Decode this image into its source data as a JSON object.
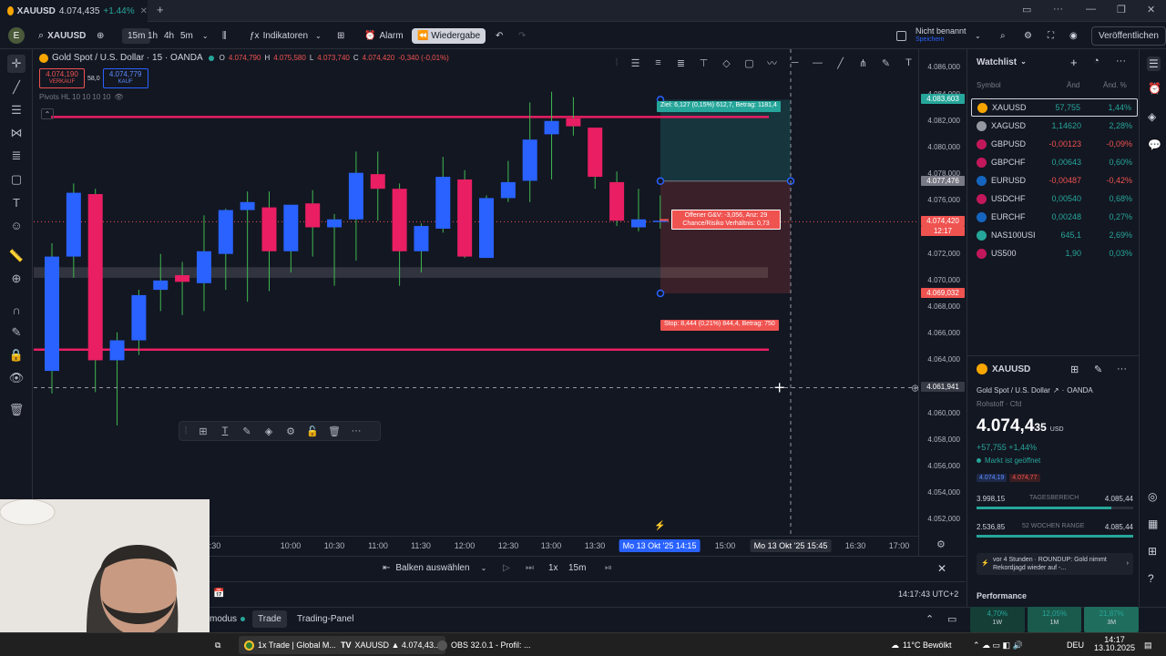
{
  "browser": {
    "tab_title": "XAUUSD ▲ 4.074,435 +1.44% / Un...",
    "tab_symbol": "XAUUSD",
    "tab_price": "4.074,435",
    "tab_change": "+1.44%",
    "new_tab": "+"
  },
  "toolbar": {
    "user_initial": "E",
    "symbol": "XAUUSD",
    "intervals": [
      "15m",
      "1h",
      "4h",
      "5m"
    ],
    "indicators_label": "Indikatoren",
    "alarm_label": "Alarm",
    "replay_label": "Wiedergabe",
    "layout_name": "Nicht benannt",
    "layout_sub": "Speichern",
    "publish_label": "Veröffentlichen"
  },
  "chart": {
    "title": "Gold Spot / U.S. Dollar · 15 · OANDA",
    "ohlc": {
      "o_label": "O",
      "o": "4.074,790",
      "h_label": "H",
      "h": "4.075,580",
      "l_label": "L",
      "l": "4.073,740",
      "c_label": "C",
      "c": "4.074,420",
      "change": "-0,340 (-0,01%)"
    },
    "sell_price": "4.074,190",
    "sell_label": "VERKAUF",
    "spread": "58,0",
    "buy_price": "4.074,779",
    "buy_label": "KAUF",
    "indicator_legend": "Pivots HL 10 10 10 10",
    "target_label": "Ziel: 6,127 (0,15%) 612,7, Betrag: 1181,4",
    "open_pnl_label": "Offener G&V: -3,056, Anz: 29",
    "risk_reward_label": "Chance/Risiko Verhältnis: 0,73",
    "stop_label": "Stop: 8,444 (0,21%) 844,4, Betrag: 750",
    "candles": [
      {
        "o": 4063.2,
        "h": 4072.8,
        "l": 4061.5,
        "c": 4071.8
      },
      {
        "o": 4071.8,
        "h": 4077.3,
        "l": 4070.2,
        "c": 4076.6
      },
      {
        "o": 4076.5,
        "h": 4076.9,
        "l": 4061.6,
        "c": 4064.0
      },
      {
        "o": 4064.0,
        "h": 4066.1,
        "l": 4059.1,
        "c": 4065.5
      },
      {
        "o": 4065.5,
        "h": 4069.3,
        "l": 4064.4,
        "c": 4068.9
      },
      {
        "o": 4069.3,
        "h": 4072.0,
        "l": 4067.7,
        "c": 4070.0
      },
      {
        "o": 4070.4,
        "h": 4071.4,
        "l": 4067.4,
        "c": 4069.9
      },
      {
        "o": 4069.8,
        "h": 4074.9,
        "l": 4067.7,
        "c": 4072.2
      },
      {
        "o": 4072.0,
        "h": 4075.4,
        "l": 4069.3,
        "c": 4075.3
      },
      {
        "o": 4075.3,
        "h": 4076.7,
        "l": 4068.4,
        "c": 4075.9
      },
      {
        "o": 4075.5,
        "h": 4076.7,
        "l": 4069.2,
        "c": 4072.2
      },
      {
        "o": 4072.2,
        "h": 4074.6,
        "l": 4070.6,
        "c": 4075.7
      },
      {
        "o": 4075.8,
        "h": 4076.8,
        "l": 4071.8,
        "c": 4074.0
      },
      {
        "o": 4074.0,
        "h": 4075.0,
        "l": 4069.6,
        "c": 4074.6
      },
      {
        "o": 4074.6,
        "h": 4079.7,
        "l": 4071.5,
        "c": 4078.1
      },
      {
        "o": 4078.0,
        "h": 4079.7,
        "l": 4074.5,
        "c": 4076.9
      },
      {
        "o": 4076.9,
        "h": 4077.3,
        "l": 4069.6,
        "c": 4072.2
      },
      {
        "o": 4072.2,
        "h": 4074.3,
        "l": 4070.6,
        "c": 4074.1
      },
      {
        "o": 4073.9,
        "h": 4079.3,
        "l": 4073.6,
        "c": 4077.8
      },
      {
        "o": 4077.6,
        "h": 4078.3,
        "l": 4071.7,
        "c": 4071.8
      },
      {
        "o": 4071.7,
        "h": 4076.4,
        "l": 4071.7,
        "c": 4076.2
      },
      {
        "o": 4076.2,
        "h": 4079.0,
        "l": 4075.9,
        "c": 4077.4
      },
      {
        "o": 4077.5,
        "h": 4083.4,
        "l": 4075.9,
        "c": 4080.6
      },
      {
        "o": 4081.0,
        "h": 4084.2,
        "l": 4077.6,
        "c": 4082.0
      },
      {
        "o": 4082.2,
        "h": 4083.8,
        "l": 4080.9,
        "c": 4081.6
      },
      {
        "o": 4081.5,
        "h": 4081.5,
        "l": 4076.9,
        "c": 4077.8
      },
      {
        "o": 4077.4,
        "h": 4078.2,
        "l": 4074.1,
        "c": 4074.5
      },
      {
        "o": 4074.0,
        "h": 4076.9,
        "l": 4073.7,
        "c": 4074.6
      },
      {
        "o": 4074.4,
        "h": 4076.4,
        "l": 4073.9,
        "c": 4074.5
      }
    ],
    "resistance_price": 4082.3,
    "support_price": 4064.8,
    "zone_top": 4071.0,
    "zone_bottom": 4070.2,
    "entry_price": 4077.476,
    "target_price": 4083.603,
    "stop_price": 4069.032,
    "crosshair_price": 4061.941,
    "price_min": 4050.8,
    "price_max": 4087.4
  },
  "price_scale": {
    "ticks": [
      "4.086,000",
      "4.084,000",
      "4.082,000",
      "4.080,000",
      "4.078,000",
      "4.076,000",
      "4.074,000",
      "4.072,000",
      "4.070,000",
      "4.068,000",
      "4.066,000",
      "4.064,000",
      "4.062,000",
      "4.060,000",
      "4.058,000",
      "4.056,000",
      "4.054,000",
      "4.052,000"
    ],
    "target_tag": "4.083,603",
    "entry_tag": "4.077,476",
    "last_price_tag": "4.074,420",
    "countdown_tag": "12:17",
    "stop_tag": "4.069,032",
    "crosshair_tag": "4.061,941",
    "colors": {
      "target": "#26a69a",
      "entry": "#787b86",
      "last": "#ef5350",
      "stop": "#ef5350",
      "crosshair": "#363a45"
    }
  },
  "time_scale": {
    "labels": [
      "09:30",
      "10:00",
      "10:30",
      "11:00",
      "11:30",
      "12:00",
      "12:30",
      "13:00",
      "13:30",
      "15:00",
      "16:30",
      "17:00"
    ],
    "start_tag": "Mo 13 Okt '25   14:15",
    "end_tag": "Mo 13 Okt '25   15:45"
  },
  "replay_bar": {
    "select_bar": "Balken auswählen",
    "speed": "1x",
    "interval": "15m"
  },
  "bottom_bar": {
    "time": "14:17:43 UTC+2"
  },
  "panel_bar": {
    "mode": "modus",
    "trade_tab": "Trade",
    "trading_panel_tab": "Trading-Panel"
  },
  "watchlist": {
    "title": "Watchlist",
    "col_symbol": "Symbol",
    "col_change": "Änd",
    "col_pct": "Änd. %",
    "rows": [
      {
        "symbol": "XAUUSD",
        "change": "57,755",
        "pct": "1,44%",
        "dir": "pos",
        "color": "#f7a600"
      },
      {
        "symbol": "XAGUSD",
        "change": "1,14620",
        "pct": "2,28%",
        "dir": "pos",
        "color": "#9598a1"
      },
      {
        "symbol": "GBPUSD",
        "change": "-0,00123",
        "pct": "-0,09%",
        "dir": "neg",
        "color": "#c2185b"
      },
      {
        "symbol": "GBPCHF",
        "change": "0,00643",
        "pct": "0,60%",
        "dir": "pos",
        "color": "#c2185b"
      },
      {
        "symbol": "EURUSD",
        "change": "-0,00487",
        "pct": "-0,42%",
        "dir": "neg",
        "color": "#1565c0"
      },
      {
        "symbol": "USDCHF",
        "change": "0,00540",
        "pct": "0,68%",
        "dir": "pos",
        "color": "#c2185b"
      },
      {
        "symbol": "EURCHF",
        "change": "0,00248",
        "pct": "0,27%",
        "dir": "pos",
        "color": "#1565c0"
      },
      {
        "symbol": "NAS100USI",
        "change": "645,1",
        "pct": "2,69%",
        "dir": "pos",
        "color": "#26a69a"
      },
      {
        "symbol": "US500",
        "change": "1,90",
        "pct": "0,03%",
        "dir": "pos",
        "color": "#c2185b"
      }
    ]
  },
  "detail": {
    "symbol": "XAUUSD",
    "name": "Gold Spot / U.S. Dollar",
    "exchange": "OANDA",
    "category": "Rohstoff · Cfd",
    "price_main": "4.074,4",
    "price_small": "35",
    "currency": "USD",
    "change": "+57,755 +1,44%",
    "market_status": "Markt ist geöffnet",
    "bid": "4.074,19",
    "ask": "4.074,77",
    "day_low": "3.998,15",
    "day_range_label": "TAGESBEREICH",
    "day_high": "4.085,44",
    "wk52_low": "2.536,85",
    "wk52_label": "52 WOCHEN RANGE",
    "wk52_high": "4.085,44",
    "news": "vor 4 Stunden · ROUNDUP: Gold nimmt Rekordjagd wieder auf -...",
    "performance_title": "Performance",
    "perf": [
      {
        "value": "4,70%",
        "period": "1W"
      },
      {
        "value": "12,05%",
        "period": "1M"
      },
      {
        "value": "21,87%",
        "period": "3M"
      }
    ]
  },
  "taskbar": {
    "items": [
      "1x Trade | Global M...",
      "XAUUSD ▲ 4.074,43...",
      "OBS 32.0.1 - Profil: ..."
    ],
    "weather": "11°C Bewölkt",
    "lang": "DEU",
    "clock_time": "14:17",
    "clock_date": "13.10.2025"
  }
}
